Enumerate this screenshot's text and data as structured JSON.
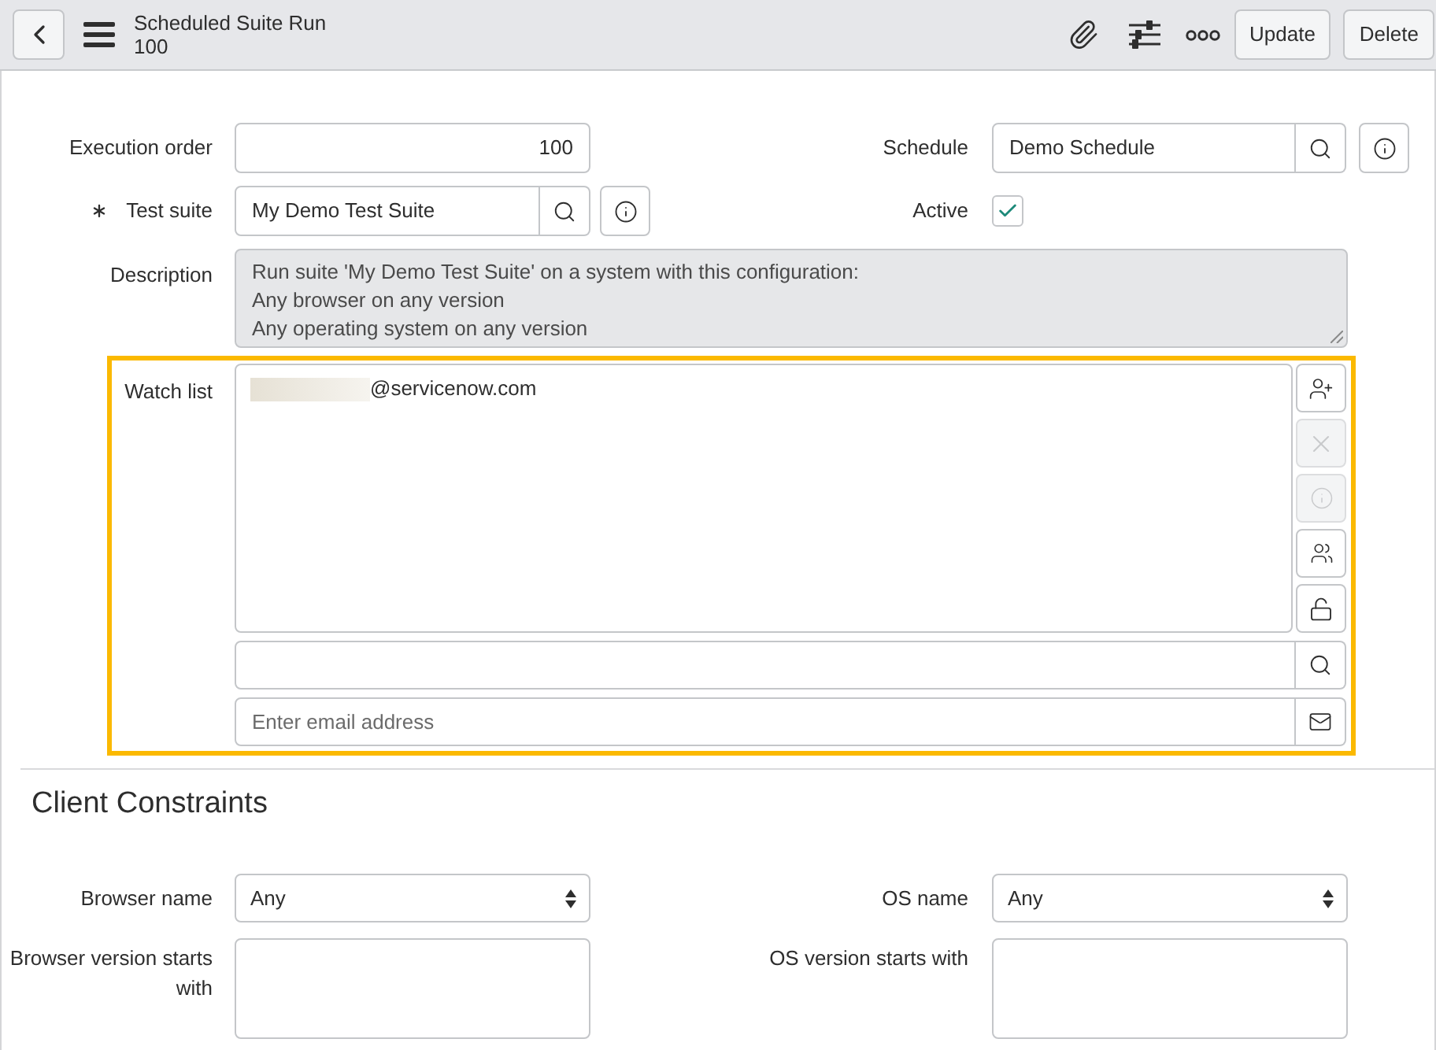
{
  "header": {
    "title": "Scheduled Suite Run",
    "subtitle": "100",
    "actions": [
      "Update",
      "Delete"
    ]
  },
  "form": {
    "execution_order": {
      "label": "Execution order",
      "value": "100"
    },
    "schedule": {
      "label": "Schedule",
      "value": "Demo Schedule"
    },
    "test_suite": {
      "label": "Test suite",
      "value": "My Demo Test Suite",
      "required": true
    },
    "active": {
      "label": "Active",
      "checked": true
    },
    "description": {
      "label": "Description",
      "lines": [
        "Run suite 'My Demo Test Suite' on a system with this configuration:",
        "Any browser on any version",
        "Any operating system on any version"
      ]
    },
    "watch_list": {
      "label": "Watch list",
      "highlighted": true,
      "entries": [
        {
          "text": "@servicenow.com",
          "redacted": true
        }
      ],
      "tools": [
        {
          "kind": "add_user",
          "disabled": false
        },
        {
          "kind": "remove",
          "disabled": true
        },
        {
          "kind": "info",
          "disabled": true
        },
        {
          "kind": "group",
          "disabled": false
        },
        {
          "kind": "unlock",
          "disabled": false
        }
      ],
      "email_placeholder": "Enter email address"
    }
  },
  "client_constraints": {
    "title": "Client Constraints",
    "browser_name": {
      "label": "Browser name",
      "value": "Any"
    },
    "os_name": {
      "label": "OS name",
      "value": "Any"
    },
    "browser_version": {
      "label": "Browser version starts with"
    },
    "os_version": {
      "label": "OS version starts with"
    }
  }
}
